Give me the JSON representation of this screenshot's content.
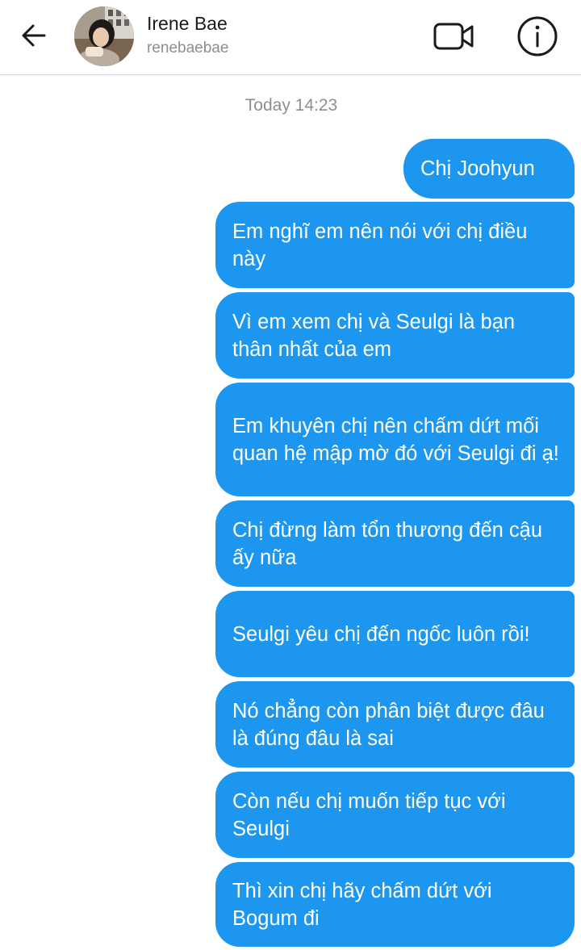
{
  "header": {
    "name": "Irene Bae",
    "username": "renebaebae",
    "back_icon": "arrow-left-icon",
    "video_icon": "video-camera-icon",
    "info_icon": "info-icon"
  },
  "conversation": {
    "timestamp": "Today 14:23",
    "messages": [
      {
        "text": "Chị Joohyun"
      },
      {
        "text": "Em nghĩ em nên nói với chị điều này"
      },
      {
        "text": "Vì em xem chị và Seulgi là bạn thân nhất của em"
      },
      {
        "text": "Em khuyên chị nên chấm dứt mối quan hệ mập mờ đó với Seulgi đi ạ!"
      },
      {
        "text": "Chị đừng làm tổn thương đến cậu ấy nữa"
      },
      {
        "text": "Seulgi yêu chị đến ngốc luôn rồi!"
      },
      {
        "text": "Nó chẳng còn phân biệt được đâu là đúng đâu là sai"
      },
      {
        "text": "Còn nếu chị muốn tiếp tục với Seulgi"
      },
      {
        "text": "Thì xin chị hãy chấm dứt với Bogum đi"
      }
    ]
  },
  "colors": {
    "bubble": "#1c96ef",
    "bubble_text": "#ffffff",
    "timestamp": "#8e8e8e",
    "header_border": "#dcdcdc"
  }
}
